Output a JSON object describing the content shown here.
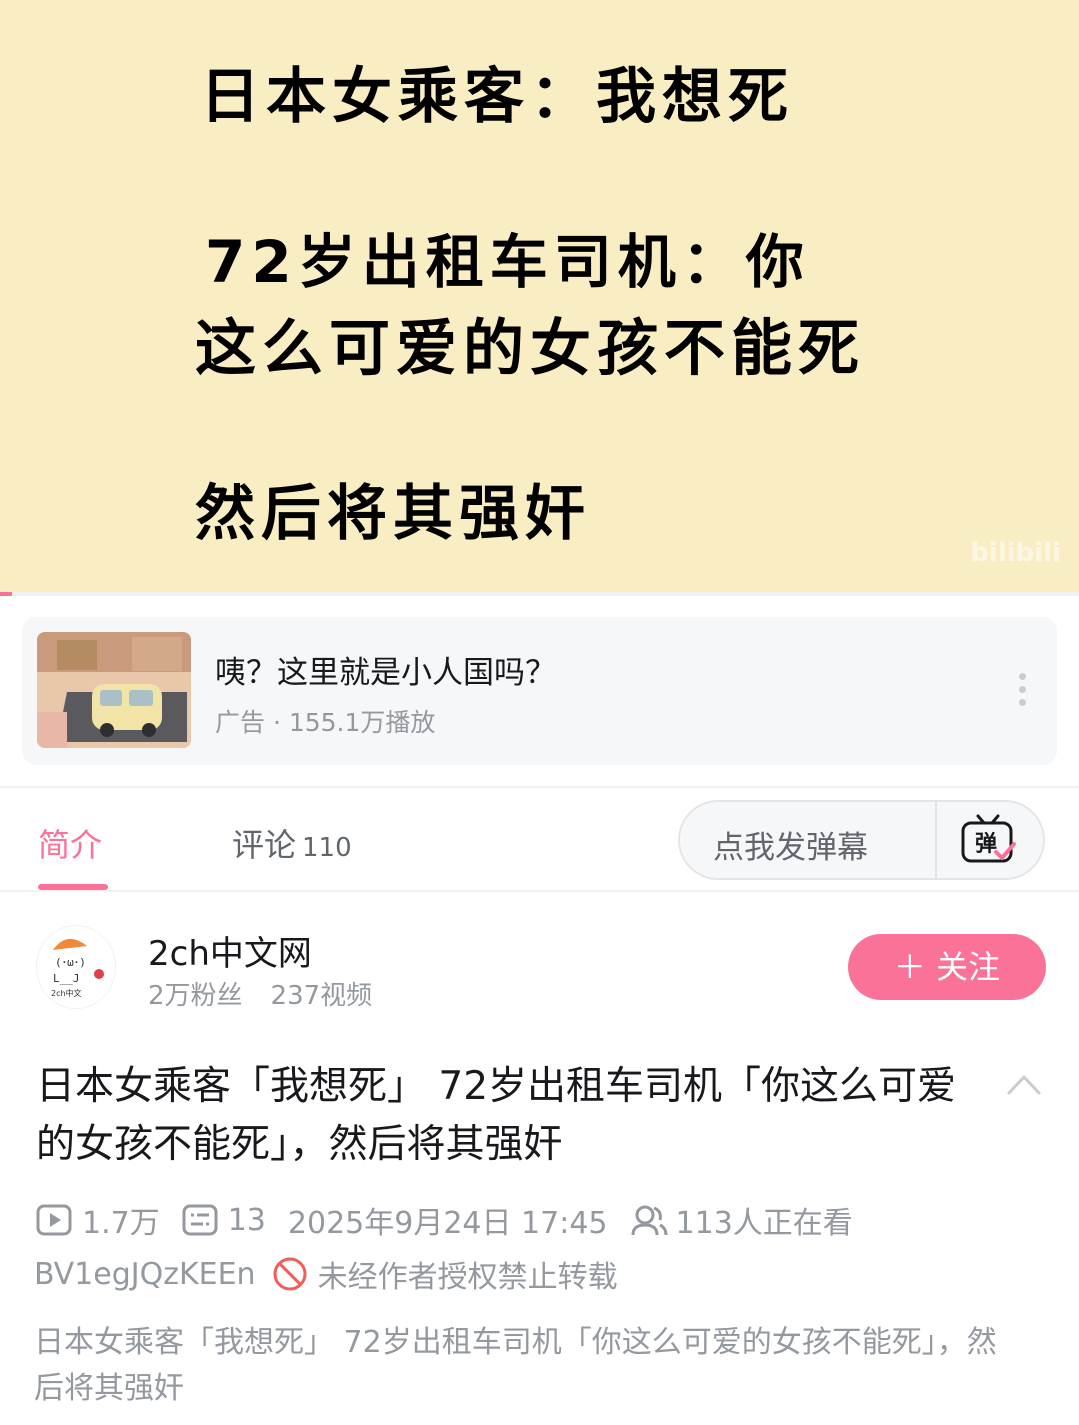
{
  "video": {
    "line1": "日本女乘客：我想死",
    "line2": "72岁出租车司机：你",
    "line3": "这么可爱的女孩不能死",
    "line4": "然后将其强奸",
    "watermark": "bilibili"
  },
  "ad": {
    "title": "咦？这里就是小人国吗？",
    "meta": "广告 · 155.1万播放"
  },
  "tabs": {
    "intro": "简介",
    "comments": "评论",
    "comments_count": "110"
  },
  "danmaku": {
    "placeholder": "点我发弹幕"
  },
  "uploader": {
    "name": "2ch中文网",
    "fans": "2万粉丝",
    "videos": "237视频",
    "follow_label": "＋ 关注"
  },
  "video_info": {
    "title": "日本女乘客「我想死」 72岁出租车司机「你这么可爱的女孩不能死」，然后将其强奸",
    "views": "1.7万",
    "danmaku_count": "13",
    "datetime": "2025年9月24日 17:45",
    "watching": "113人正在看",
    "bvid": "BV1egJQzKEEn",
    "copyright": "未经作者授权禁止转载",
    "description": "日本女乘客「我想死」 72岁出租车司机「你这么可爱的女孩不能死」，然后将其强奸"
  },
  "colors": {
    "accent": "#fb7299",
    "video_bg": "#f9eec3",
    "muted": "#9499a0"
  }
}
